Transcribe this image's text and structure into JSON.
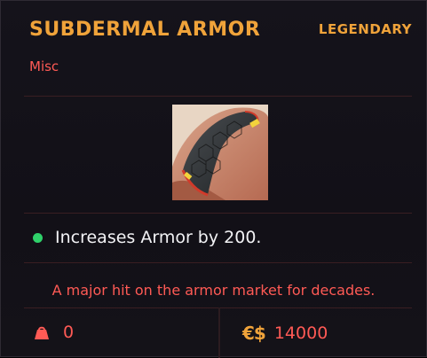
{
  "item": {
    "name": "SUBDERMAL ARMOR",
    "rarity": "LEGENDARY",
    "category": "Misc",
    "image_icon": "subdermal-armor-icon"
  },
  "stats": [
    {
      "text": "Increases Armor by 200.",
      "color": "#2fd16a"
    }
  ],
  "description": "A major hit on the armor market for decades.",
  "footer": {
    "weight_icon": "weight-icon",
    "weight": "0",
    "currency_symbol": "€$",
    "price": "14000"
  },
  "colors": {
    "rarity": "#f0a33a",
    "accent_red": "#ff5a55",
    "background": "#13111a"
  }
}
